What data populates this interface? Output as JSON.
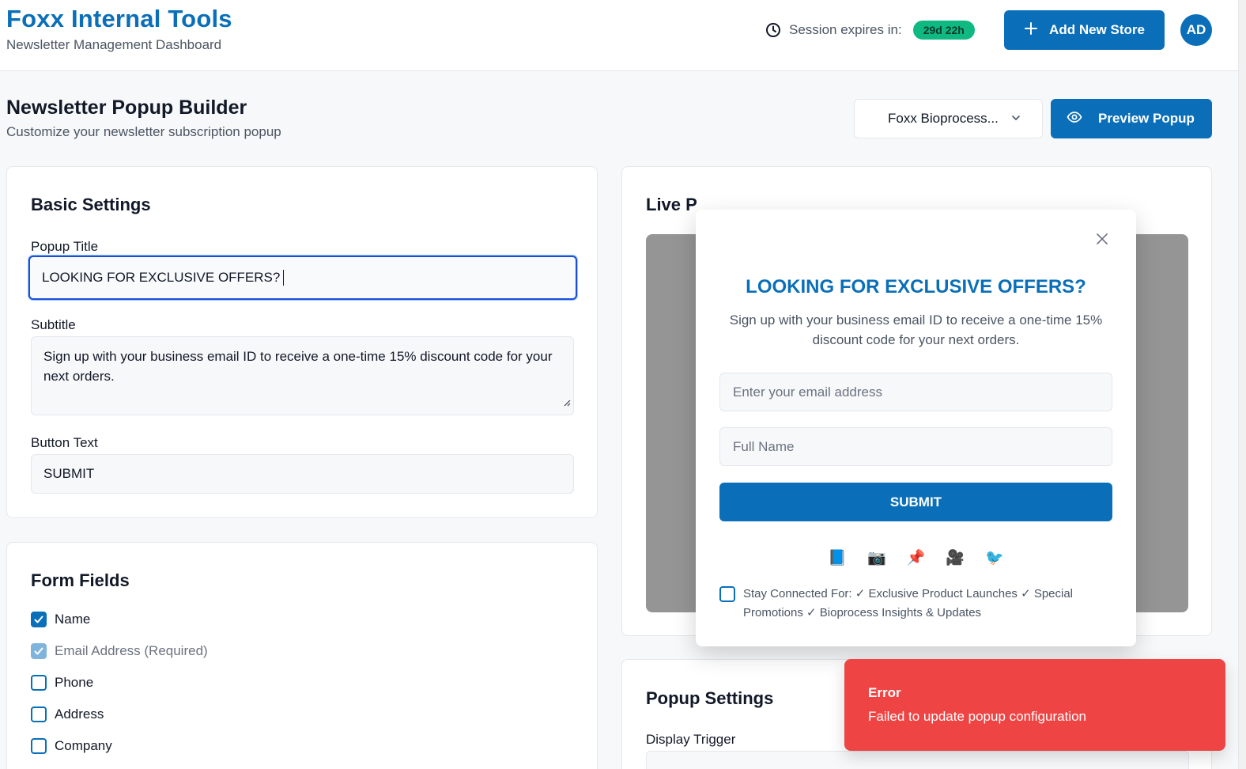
{
  "header": {
    "app_title": "Foxx Internal Tools",
    "app_subtitle": "Newsletter Management Dashboard",
    "session_label": "Session expires in:",
    "session_value": "29d 22h",
    "add_store_label": "Add New Store",
    "avatar_initials": "AD"
  },
  "page": {
    "title": "Newsletter Popup Builder",
    "subtitle": "Customize your newsletter subscription popup",
    "store_select_value": "Foxx Bioprocess...",
    "preview_button_label": "Preview Popup"
  },
  "basic_settings": {
    "title": "Basic Settings",
    "popup_title_label": "Popup Title",
    "popup_title_value": "LOOKING FOR EXCLUSIVE OFFERS?",
    "subtitle_label": "Subtitle",
    "subtitle_value": "Sign up with your business email ID to receive a one-time 15% discount code for your next orders.",
    "button_text_label": "Button Text",
    "button_text_value": "SUBMIT"
  },
  "form_fields": {
    "title": "Form Fields",
    "items": [
      {
        "label": "Name",
        "checked": true
      },
      {
        "label": "Email Address (Required)",
        "checked": true
      },
      {
        "label": "Phone",
        "checked": false
      },
      {
        "label": "Address",
        "checked": false
      },
      {
        "label": "Company",
        "checked": false
      }
    ]
  },
  "live_preview": {
    "title": "Live P"
  },
  "popup": {
    "title": "LOOKING FOR EXCLUSIVE OFFERS?",
    "subtitle": "Sign up with your business email ID to receive a one-time 15% discount code for your next orders.",
    "email_placeholder": "Enter your email address",
    "name_placeholder": "Full Name",
    "submit_label": "SUBMIT",
    "social_icons": [
      "📘",
      "📷",
      "📌",
      "🎥",
      "🐦"
    ],
    "stay_connected": "Stay Connected For: ✓ Exclusive Product Launches ✓ Special Promotions ✓ Bioprocess Insights & Updates"
  },
  "popup_settings": {
    "title": "Popup Settings",
    "display_trigger_label": "Display Trigger"
  },
  "toast": {
    "title": "Error",
    "message": "Failed to update popup configuration"
  },
  "colors": {
    "brand": "#0a6fb8",
    "session_badge": "#10b981",
    "error": "#ef4444",
    "preview_backdrop": "#959595"
  }
}
